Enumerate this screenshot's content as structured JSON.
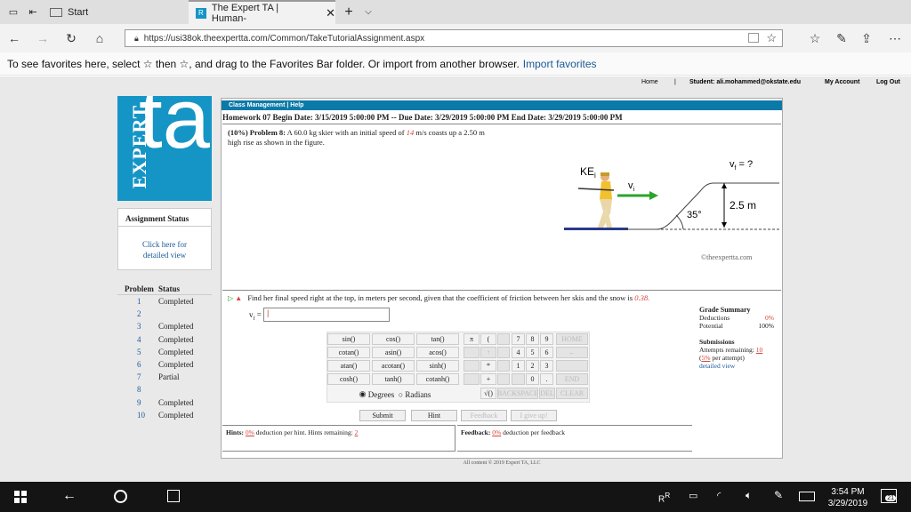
{
  "browser": {
    "tabs": [
      {
        "label": "Start"
      },
      {
        "label": "The Expert TA | Human-"
      }
    ],
    "url": "https://usi38ok.theexpertta.com/Common/TakeTutorialAssignment.aspx",
    "favorites_text": "To see favorites here, select ☆ then ☆, and drag to the Favorites Bar folder. Or import from another browser.",
    "favorites_link": "Import favorites"
  },
  "site": {
    "top_links": [
      "Home",
      "|",
      "Student: ali.mohammed@okstate.edu",
      "My Account",
      "Log Out"
    ],
    "logo_text_vertical": "EXPERT",
    "logo_text_big": "ta",
    "menu_bar": "Class Management  |  Help",
    "assignment_status_title": "Assignment Status",
    "detail_link": "Click here for detailed view",
    "problem_header": "Problem",
    "status_header": "Status",
    "problems": [
      {
        "num": "1",
        "status": "Completed"
      },
      {
        "num": "2",
        "status": ""
      },
      {
        "num": "3",
        "status": "Completed"
      },
      {
        "num": "4",
        "status": "Completed"
      },
      {
        "num": "5",
        "status": "Completed"
      },
      {
        "num": "6",
        "status": "Completed"
      },
      {
        "num": "7",
        "status": "Partial"
      },
      {
        "num": "8",
        "status": ""
      },
      {
        "num": "9",
        "status": "Completed"
      },
      {
        "num": "10",
        "status": "Completed"
      }
    ]
  },
  "assignment": {
    "header": "Homework 07 Begin Date: 3/15/2019 5:00:00 PM -- Due Date: 3/29/2019 5:00:00 PM End Date: 3/29/2019 5:00:00 PM",
    "problem_weight": "(10%) Problem 8:",
    "problem_text_1": "A 60.0 kg skier with an initial speed of",
    "speed_value": "14",
    "problem_text_2": "m/s coasts up a 2.50 m",
    "problem_text_3": "high rise as shown in the figure.",
    "figure": {
      "vf_label": "v",
      "vf_sub": "f",
      "vf_eq": " = ?",
      "ke_label": "KE",
      "ke_sub": "i",
      "vi_label": "v",
      "vi_sub": "i",
      "height_label": "2.5 m",
      "angle_label": "35°",
      "copyright": "©theexpertta.com"
    },
    "question": "Find her final speed right at the top, in meters per second, given that the coefficient of friction between her skis and the snow is",
    "mu_value": "0.38.",
    "answer_label": "v",
    "answer_sub": "f",
    "answer_eq": " = ",
    "answer_value": ""
  },
  "grade_summary": {
    "title": "Grade Summary",
    "deductions_label": "Deductions",
    "deductions_value": "0%",
    "potential_label": "Potential",
    "potential_value": "100%",
    "submissions_title": "Submissions",
    "attempts_label": "Attempts remaining:",
    "attempts_value": "10",
    "per_attempt_pct": "5%",
    "per_attempt_label": "per attempt)",
    "detailed_view": "detailed view"
  },
  "calculator": {
    "functions": [
      [
        "sin()",
        "cos()",
        "tan()"
      ],
      [
        "cotan()",
        "asin()",
        "acos()"
      ],
      [
        "atan()",
        "acotan()",
        "sinh()"
      ],
      [
        "cosh()",
        "tanh()",
        "cotanh()"
      ]
    ],
    "col_pi": [
      "π",
      "",
      "",
      ""
    ],
    "col_paren": [
      "(",
      "↑",
      "*",
      "+"
    ],
    "digits": [
      [
        "7",
        "8",
        "9"
      ],
      [
        "4",
        "5",
        "6"
      ],
      [
        "1",
        "2",
        "3"
      ],
      [
        "",
        "0",
        "."
      ]
    ],
    "right_col": [
      "HOME",
      "←",
      "",
      "END"
    ],
    "sqrt": "√()",
    "backspace": "BACKSPACE",
    "del": "DEL",
    "clear": "CLEAR",
    "degrees": "Degrees",
    "radians": "Radians"
  },
  "actions": {
    "submit": "Submit",
    "hint": "Hint",
    "feedback": "Feedback",
    "give_up": "I give up!"
  },
  "hints": {
    "label": "Hints:",
    "pct": "0%",
    "text": "deduction per hint. Hints remaining:",
    "remaining": "2"
  },
  "feedback": {
    "label": "Feedback:",
    "pct": "0%",
    "text": "deduction per feedback"
  },
  "footer": "All content © 2019 Expert TA, LLC",
  "taskbar": {
    "time": "3:54 PM",
    "date": "3/29/2019",
    "notifications": "21"
  },
  "colors": {
    "brand_blue": "#1595c6",
    "menu_blue": "#0b7aa8",
    "link_blue": "#1a5a9a",
    "red_value": "#d8433a"
  }
}
